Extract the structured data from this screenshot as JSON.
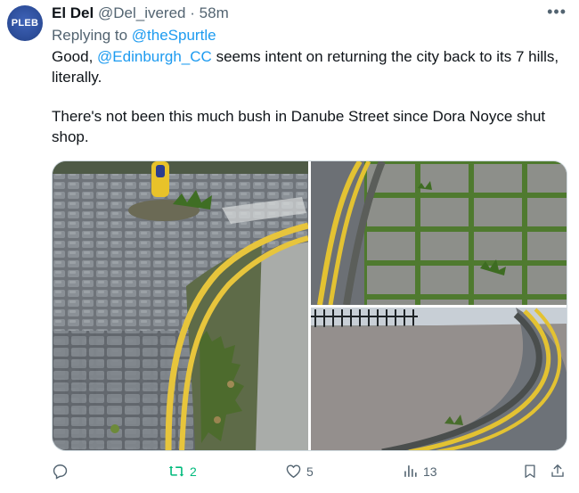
{
  "avatar": {
    "label": "PLEB",
    "color": "#2e4f9c"
  },
  "header": {
    "name": "El Del",
    "handle": "@Del_ivered",
    "separator": "·",
    "time": "58m",
    "more_icon": "more-horizontal-icon"
  },
  "reply": {
    "prefix": "Replying to",
    "mention": "@theSpurtle"
  },
  "tweet": {
    "line1_before": "Good,",
    "line1_mention": "@Edinburgh_CC",
    "line1_after": "seems intent on returning the city back to its 7 hills, literally.",
    "paragraph2": "There's not been this much bush in Danube Street since Dora Noyce shut shop."
  },
  "media": {
    "photos": [
      "cobblestone-kerb-photo",
      "weedy-pavement-photo",
      "curved-pavement-photo"
    ]
  },
  "actions": {
    "reply_icon": "reply-icon",
    "retweet_icon": "retweet-icon",
    "retweet_count": "2",
    "like_icon": "heart-icon",
    "like_count": "5",
    "views_icon": "views-icon",
    "views_count": "13",
    "bookmark_icon": "bookmark-icon",
    "share_icon": "share-icon"
  },
  "colors": {
    "link": "#1d9bf0",
    "muted": "#536471",
    "retweet": "#00ba7c",
    "text": "#0f1419"
  }
}
